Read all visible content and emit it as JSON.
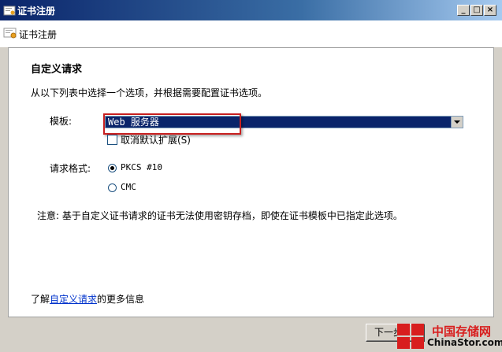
{
  "window": {
    "title": "证书注册",
    "controls": [
      "_",
      "□",
      "×"
    ]
  },
  "header": {
    "title": "证书注册"
  },
  "section": {
    "title": "自定义请求",
    "description": "从以下列表中选择一个选项，并根据需要配置证书选项。"
  },
  "template": {
    "label": "模板:",
    "selected": "Web 服务器"
  },
  "checkbox": {
    "label": "取消默认扩展(S)",
    "checked": false
  },
  "format": {
    "label": "请求格式:",
    "options": [
      "PKCS #10",
      "CMC"
    ],
    "selected": "PKCS #10"
  },
  "note": "注意: 基于自定义证书请求的证书无法使用密钥存档，即使在证书模板中已指定此选项。",
  "learn_more": {
    "prefix": "了解",
    "link": "自定义请求",
    "suffix": "的更多信息"
  },
  "buttons": {
    "next": "下一步"
  },
  "watermark": {
    "zh": "中国存储网",
    "en": "ChinaStor.com"
  }
}
